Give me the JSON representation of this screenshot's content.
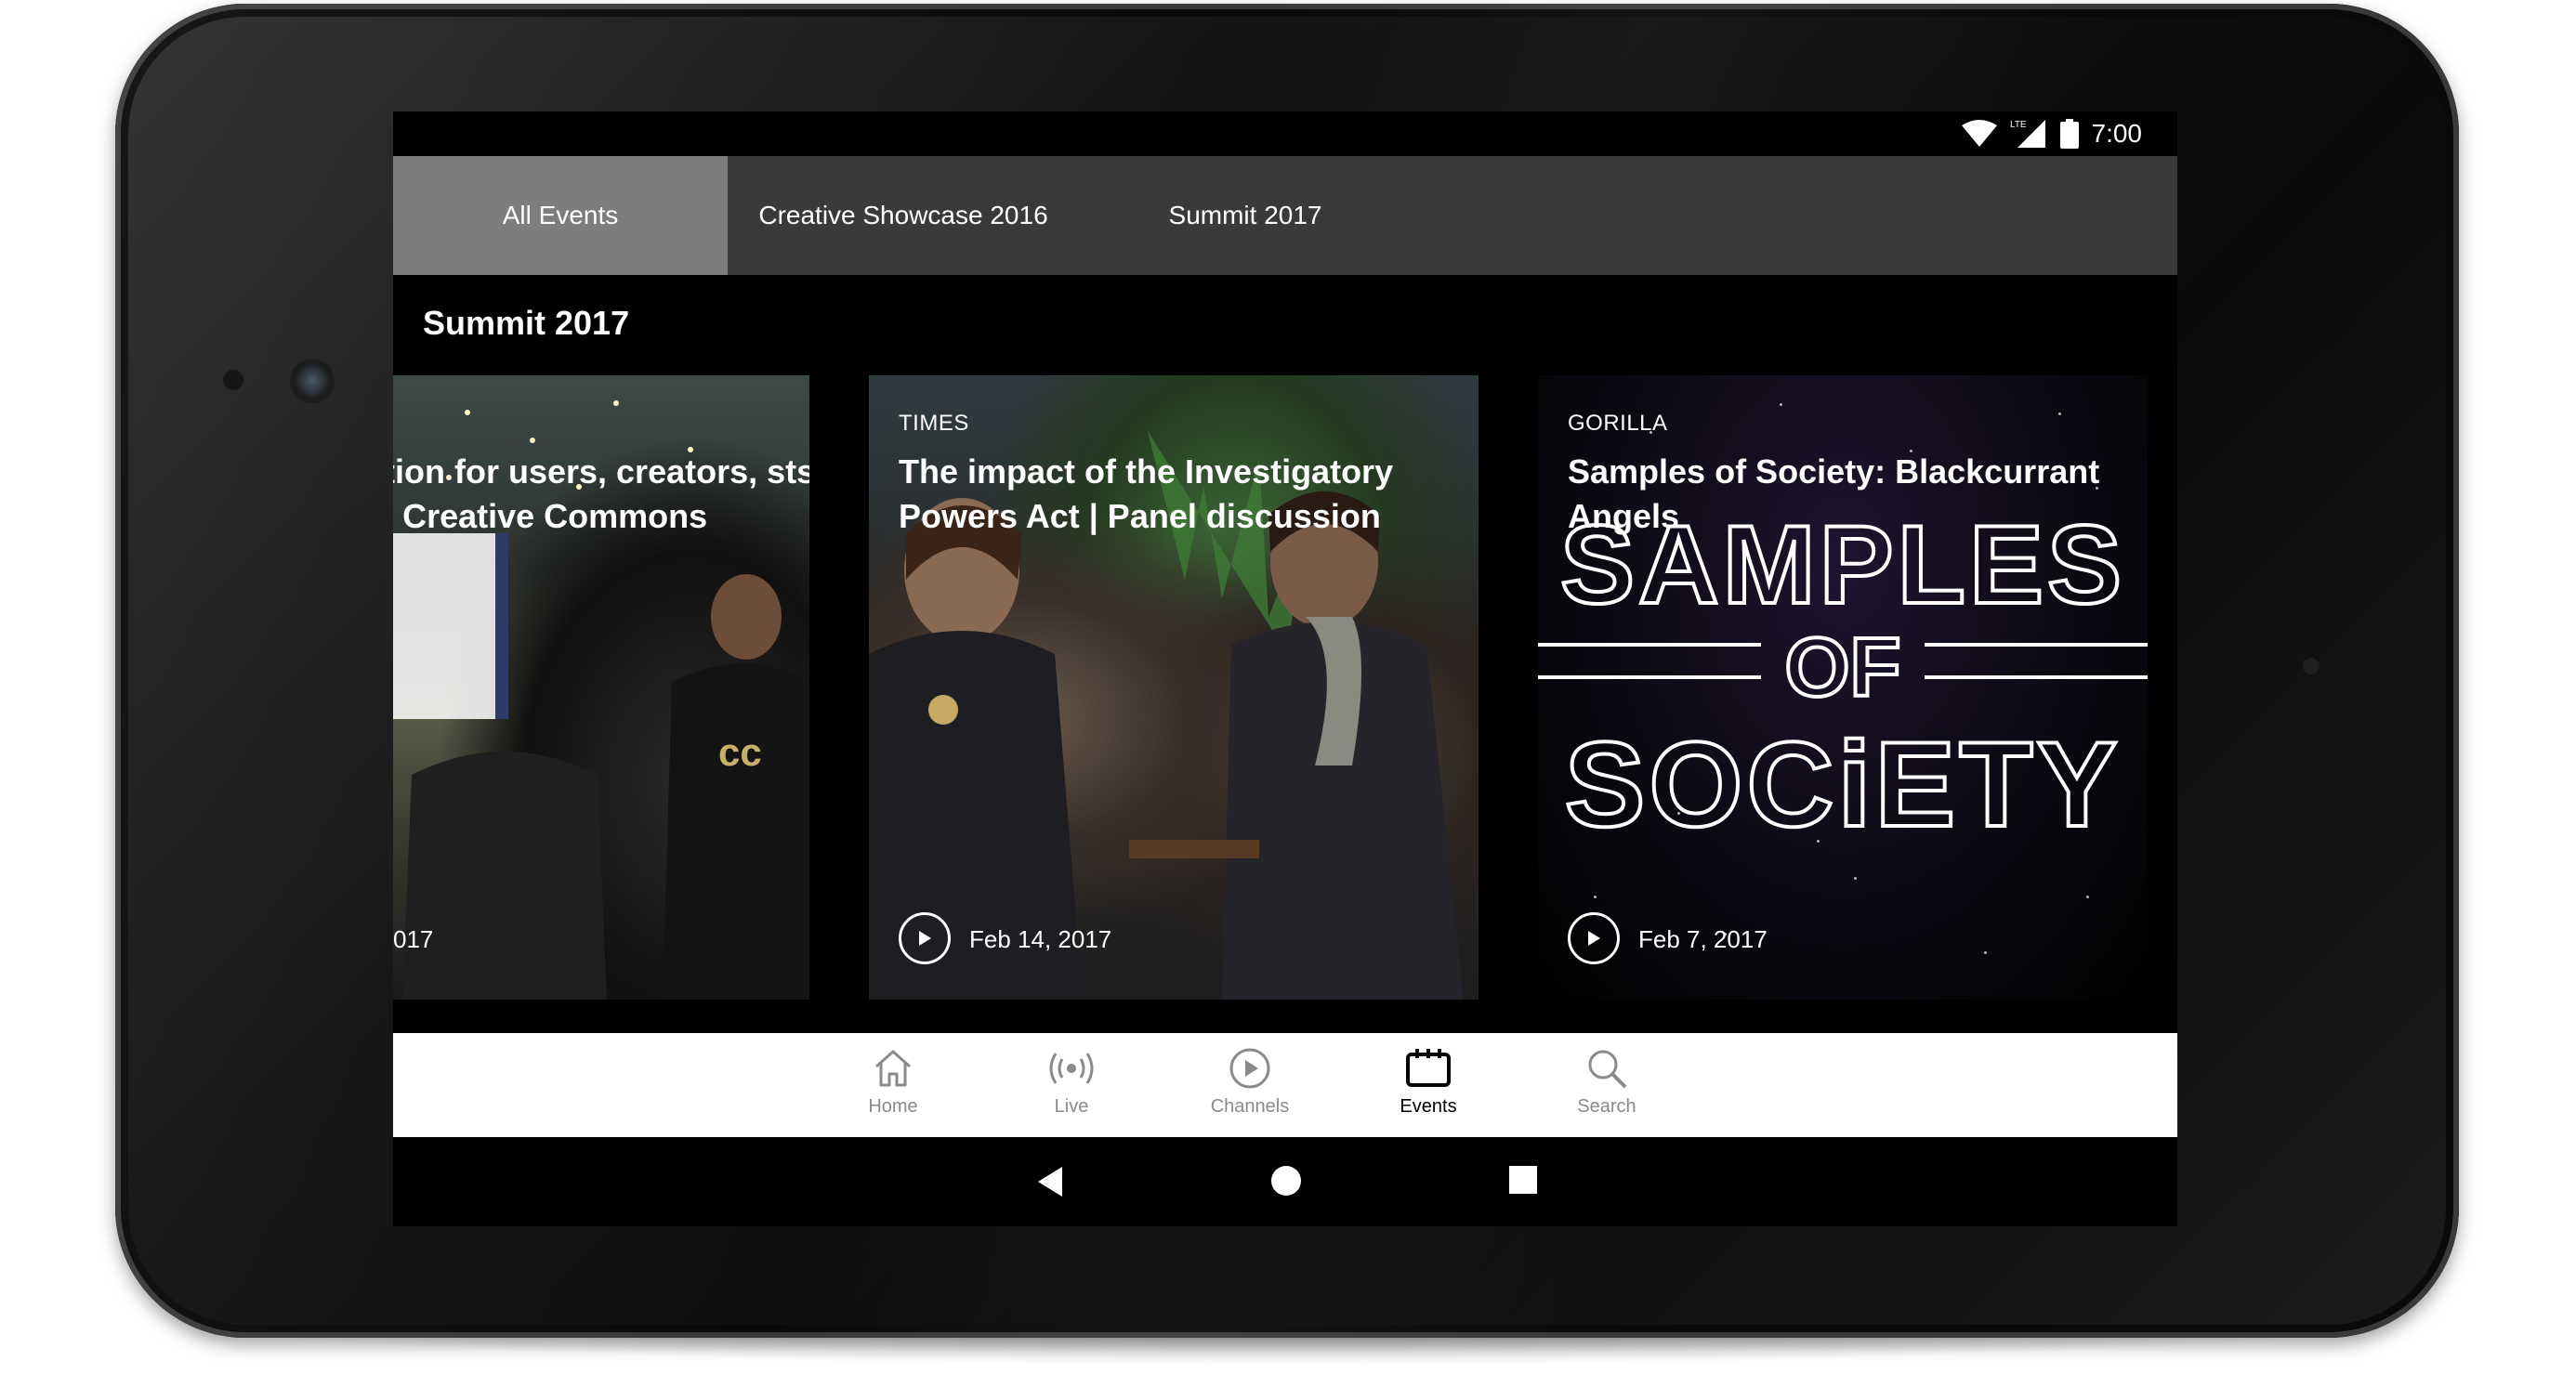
{
  "status_bar": {
    "time": "7:00",
    "network": "LTE"
  },
  "tabs": [
    {
      "label": "All Events",
      "active": true
    },
    {
      "label": "Creative Showcase 2016",
      "active": false
    },
    {
      "label": "Summit 2017",
      "active": false
    }
  ],
  "section": {
    "title": "Summit 2017"
  },
  "cards": [
    {
      "title": "tion for users, creators, sts | Creative Commons",
      "date": "017"
    },
    {
      "label": "TIMES",
      "title": "The impact of the Investigatory Powers Act | Panel discussion",
      "date": "Feb 14, 2017"
    },
    {
      "label": "GORILLA",
      "title": "Samples of Society: Blackcurrant Angels",
      "date": "Feb 7, 2017",
      "artwork_text": "SAMPLES OF SOCIETY"
    }
  ],
  "bottom_nav": [
    {
      "label": "Home",
      "icon": "home-icon",
      "active": false
    },
    {
      "label": "Live",
      "icon": "live-icon",
      "active": false
    },
    {
      "label": "Channels",
      "icon": "play-circle-icon",
      "active": false
    },
    {
      "label": "Events",
      "icon": "calendar-icon",
      "active": true
    },
    {
      "label": "Search",
      "icon": "search-icon",
      "active": false
    }
  ],
  "system_nav": [
    "back-icon",
    "home-circle-icon",
    "recents-icon"
  ],
  "colors": {
    "tab_bar": "#3a3a3a",
    "tab_active": "#7d7d7d",
    "nav_inactive": "#8a8a8a",
    "nav_active": "#000000"
  }
}
